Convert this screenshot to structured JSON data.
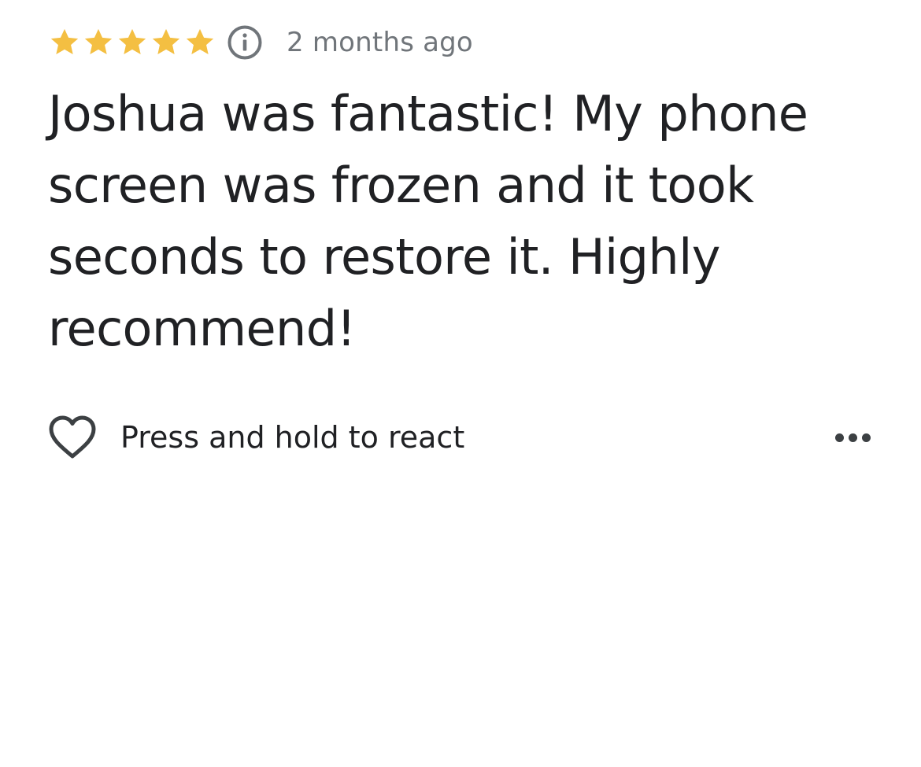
{
  "review": {
    "rating": 5,
    "max_rating": 5,
    "star_color": "#f4bf42",
    "info_icon": "info-icon",
    "time_ago": "2 months ago",
    "text": "Joshua was fantastic! My phone screen was frozen and it took seconds to restore it. Highly recommend!"
  },
  "actions": {
    "react_icon": "heart-outline-icon",
    "react_label": "Press and hold to react",
    "more_icon": "more-horizontal-icon"
  },
  "colors": {
    "primary_text": "#202124",
    "secondary_text": "#70757a",
    "icon": "#3c4043"
  }
}
